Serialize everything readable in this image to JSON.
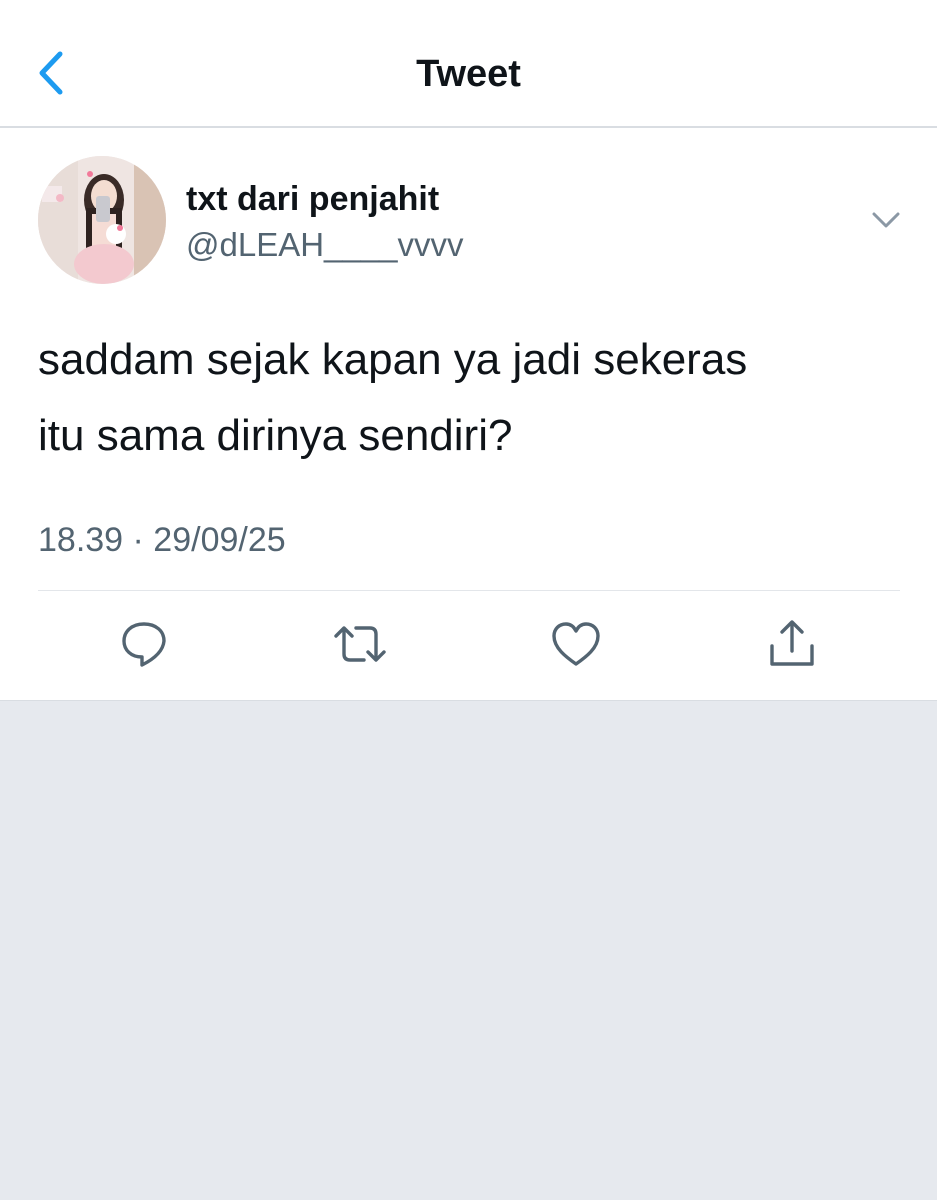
{
  "header": {
    "title": "Tweet",
    "back_icon": "chevron-left-icon"
  },
  "tweet": {
    "author": {
      "display_name": "txt dari penjahit",
      "handle": "@dLEAH____vvvv",
      "avatar": "avatar-photo"
    },
    "text": "saddam sejak kapan ya jadi sekeras\nitu sama dirinya sendiri?",
    "timestamp": "18.39 · 29/09/25",
    "actions": [
      "reply-icon",
      "retweet-icon",
      "like-icon",
      "share-icon"
    ]
  },
  "colors": {
    "accent": "#1d9bf0",
    "secondary_text": "#536471",
    "icon": "#536471",
    "background": "#e6e9ee",
    "card": "#ffffff"
  }
}
